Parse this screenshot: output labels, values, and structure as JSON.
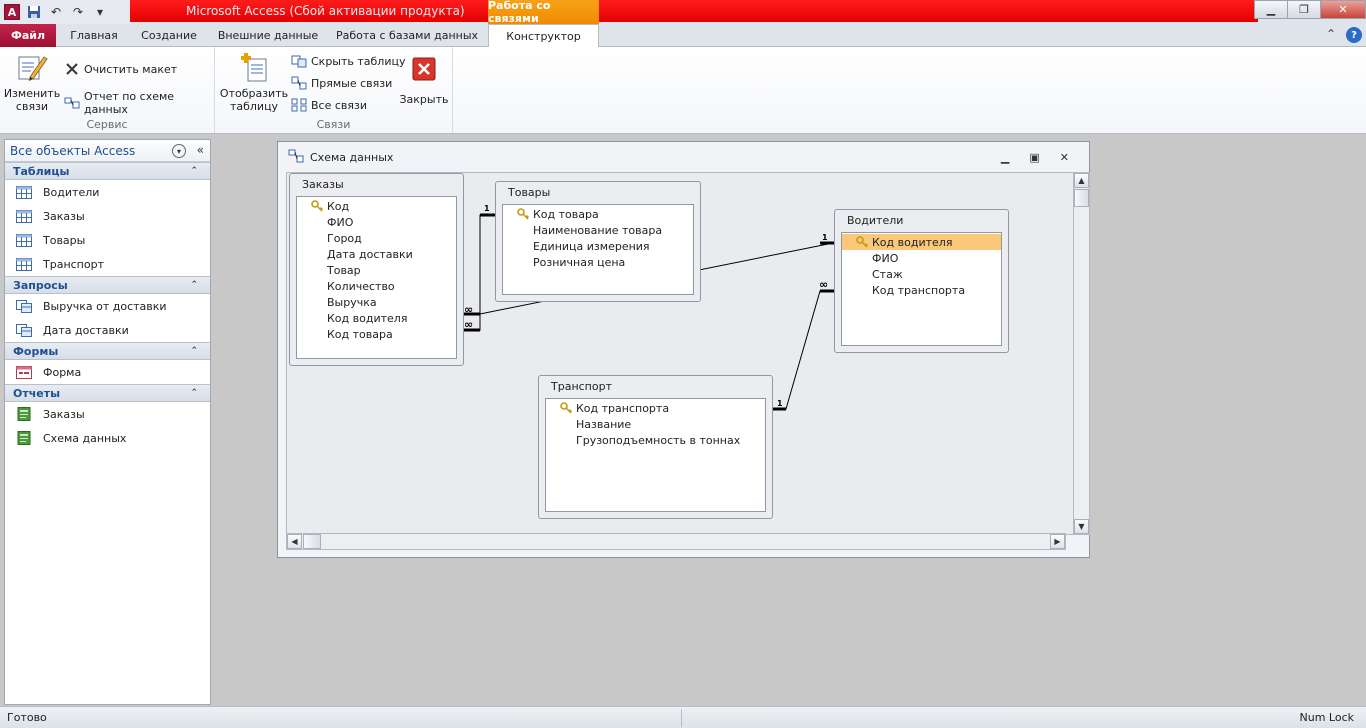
{
  "window": {
    "title": "Microsoft Access (Сбой активации продукта)",
    "context_tab": "Работа со связями",
    "logo_letter": "A"
  },
  "tabs": {
    "file": "Файл",
    "home": "Главная",
    "create": "Создание",
    "external": "Внешние данные",
    "database": "Работа с базами данных",
    "design": "Конструктор"
  },
  "ribbon": {
    "edit_relations": "Изменить связи",
    "clear_layout": "Очистить макет",
    "relation_report": "Отчет по схеме данных",
    "group_service": "Сервис",
    "show_table": "Отобразить таблицу",
    "hide_table": "Скрыть таблицу",
    "direct_relations": "Прямые связи",
    "all_relations": "Все связи",
    "close": "Закрыть",
    "group_relations": "Связи"
  },
  "nav": {
    "title": "Все объекты Access",
    "sections": {
      "tables": "Таблицы",
      "queries": "Запросы",
      "forms": "Формы",
      "reports": "Отчеты"
    },
    "tables": [
      "Водители",
      "Заказы",
      "Товары",
      "Транспорт"
    ],
    "queries": [
      "Выручка от доставки",
      "Дата доставки"
    ],
    "forms": [
      "Форма"
    ],
    "reports": [
      "Заказы",
      "Схема данных"
    ]
  },
  "schema": {
    "title": "Схема данных",
    "tables": {
      "orders": {
        "name": "Заказы",
        "fields": [
          "Код",
          "ФИО",
          "Город",
          "Дата доставки",
          "Товар",
          "Количество",
          "Выручка",
          "Код водителя",
          "Код товара"
        ]
      },
      "goods": {
        "name": "Товары",
        "fields": [
          "Код товара",
          "Наименование товара",
          "Единица измерения",
          "Розничная цена"
        ]
      },
      "drivers": {
        "name": "Водители",
        "fields": [
          "Код водителя",
          "ФИО",
          "Стаж",
          "Код транспорта"
        ]
      },
      "transport": {
        "name": "Транспорт",
        "fields": [
          "Код транспорта",
          "Название",
          "Грузоподъемность в тоннах"
        ]
      }
    },
    "rel_one": "1",
    "rel_many": "∞"
  },
  "status": {
    "left": "Готово",
    "right": "Num Lock"
  }
}
